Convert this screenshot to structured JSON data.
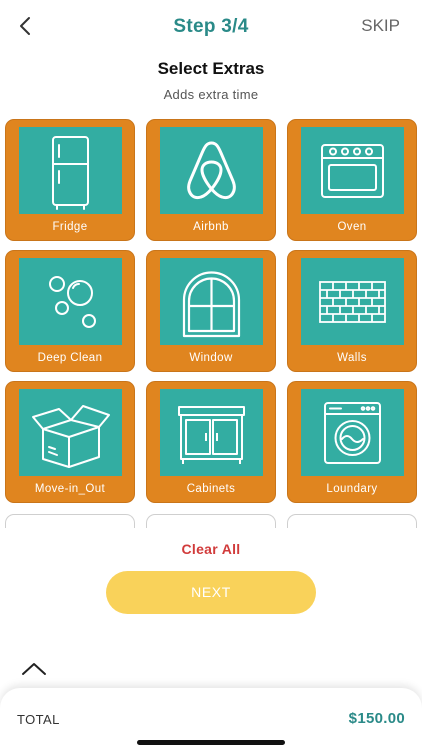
{
  "header": {
    "step": "Step 3/4",
    "skip": "SKIP"
  },
  "title": "Select Extras",
  "subtitle": "Adds extra time",
  "extras": [
    {
      "label": "Fridge",
      "icon": "fridge-icon"
    },
    {
      "label": "Airbnb",
      "icon": "airbnb-icon"
    },
    {
      "label": "Oven",
      "icon": "oven-icon"
    },
    {
      "label": "Deep Clean",
      "icon": "bubbles-icon"
    },
    {
      "label": "Window",
      "icon": "window-icon"
    },
    {
      "label": "Walls",
      "icon": "brick-wall-icon"
    },
    {
      "label": "Move-in_Out",
      "icon": "box-icon"
    },
    {
      "label": "Cabinets",
      "icon": "cabinet-icon"
    },
    {
      "label": "Loundary",
      "icon": "washing-machine-icon"
    }
  ],
  "actions": {
    "clear_all": "Clear All",
    "next": "NEXT"
  },
  "footer": {
    "total_label": "TOTAL",
    "total_value": "$150.00"
  },
  "colors": {
    "accent_teal": "#2a8a88",
    "card_orange": "#e0851f",
    "tile_teal": "#33ada2",
    "next_yellow": "#f9d25a",
    "clear_red": "#d13b3b"
  }
}
